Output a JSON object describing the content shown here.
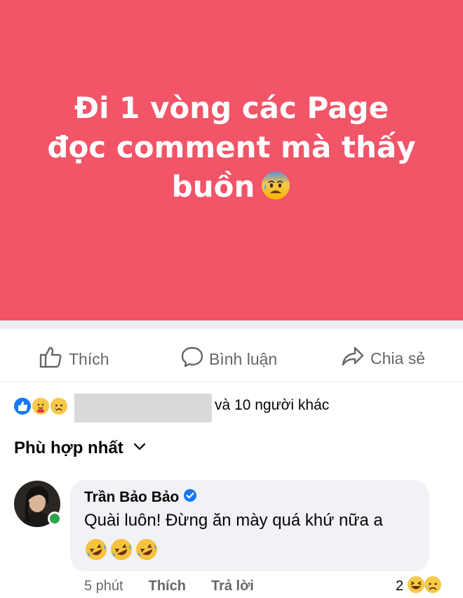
{
  "post": {
    "text_line1": "Đi 1 vòng các Page",
    "text_line2": "đọc comment mà thấy",
    "text_line3": "buồn",
    "text_emoji": "anxious-face-with-sweat-icon",
    "background_color": "#f25468"
  },
  "actions": {
    "like_label": "Thích",
    "comment_label": "Bình luận",
    "share_label": "Chia sẻ"
  },
  "reactions": {
    "icons": [
      "like-icon",
      "care-icon",
      "sad-icon"
    ],
    "summary": "và 10 người khác"
  },
  "sort": {
    "label": "Phù hợp nhất"
  },
  "comment": {
    "author": "Trần Bảo Bảo",
    "verified": true,
    "text": "Quài luôn! Đừng ăn mày quá khứ nữa a",
    "emojis": [
      "rolling-on-floor-laughing-icon",
      "rolling-on-floor-laughing-icon",
      "rolling-on-floor-laughing-icon"
    ],
    "time": "5 phút",
    "like_label": "Thích",
    "reply_label": "Trả lời",
    "reaction_count": "2",
    "reaction_icons": [
      "laughing-icon",
      "sad-icon"
    ]
  },
  "colors": {
    "accent_blue": "#1877f2",
    "online_green": "#31a24c",
    "muted_text": "#65676b",
    "bubble_bg": "#f0f2f5"
  }
}
